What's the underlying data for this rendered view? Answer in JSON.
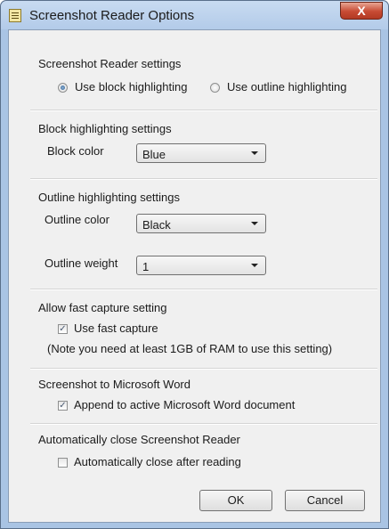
{
  "window": {
    "title": "Screenshot Reader Options",
    "close_glyph": "X"
  },
  "screenshot_reader": {
    "heading": "Screenshot Reader settings",
    "options": [
      {
        "label": "Use block highlighting",
        "selected": true
      },
      {
        "label": "Use outline highlighting",
        "selected": false
      }
    ]
  },
  "block": {
    "heading": "Block highlighting settings",
    "color_label": "Block color",
    "color_value": "Blue"
  },
  "outline": {
    "heading": "Outline highlighting settings",
    "color_label": "Outline color",
    "color_value": "Black",
    "weight_label": "Outline weight",
    "weight_value": "1"
  },
  "fast_capture": {
    "heading": "Allow fast capture setting",
    "checkbox_label": "Use fast capture",
    "checked": true,
    "note": "(Note you need at least 1GB of RAM to use this setting)"
  },
  "word": {
    "heading": "Screenshot to Microsoft Word",
    "checkbox_label": "Append to active Microsoft Word document",
    "checked": true
  },
  "auto_close": {
    "heading": "Automatically close Screenshot Reader",
    "checkbox_label": "Automatically close after reading",
    "checked": false
  },
  "buttons": {
    "ok": "OK",
    "cancel": "Cancel"
  },
  "colors": {
    "frame": "#a9c4e4",
    "client": "#f0f0f0",
    "close_button": "#c74a33"
  }
}
